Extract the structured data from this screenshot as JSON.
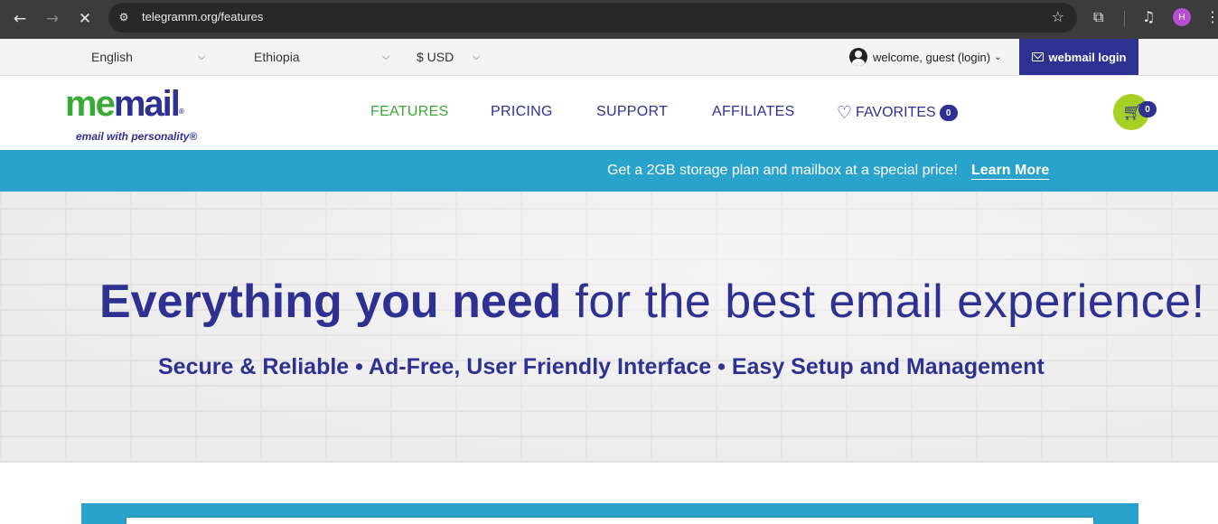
{
  "browser": {
    "url": "telegramm.org/features",
    "profile_initial": "H"
  },
  "utility_bar": {
    "language": "English",
    "country": "Ethiopia",
    "currency": "$ USD",
    "guest_text": "welcome, guest (login)",
    "webmail_login": "webmail login"
  },
  "logo": {
    "me": "me",
    "mail": "mail",
    "registered": "®",
    "tagline": "email with personality®"
  },
  "nav": {
    "features": "FEATURES",
    "pricing": "PRICING",
    "support": "SUPPORT",
    "affiliates": "AFFILIATES",
    "favorites": "FAVORITES",
    "favorites_count": "0",
    "cart_count": "0"
  },
  "promo": {
    "text": "Get a 2GB storage plan and mailbox at a special price!",
    "link": "Learn More"
  },
  "hero": {
    "headline_strong": "Everything you need",
    "headline_light": " for the best email experience!",
    "subline": "Secure & Reliable • Ad-Free, User Friendly Interface • Easy Setup and Management"
  },
  "colors": {
    "brand_blue": "#2e3192",
    "brand_green": "#3aaa35",
    "promo_blue": "#29a3cc",
    "cart_green": "#a6d024"
  }
}
